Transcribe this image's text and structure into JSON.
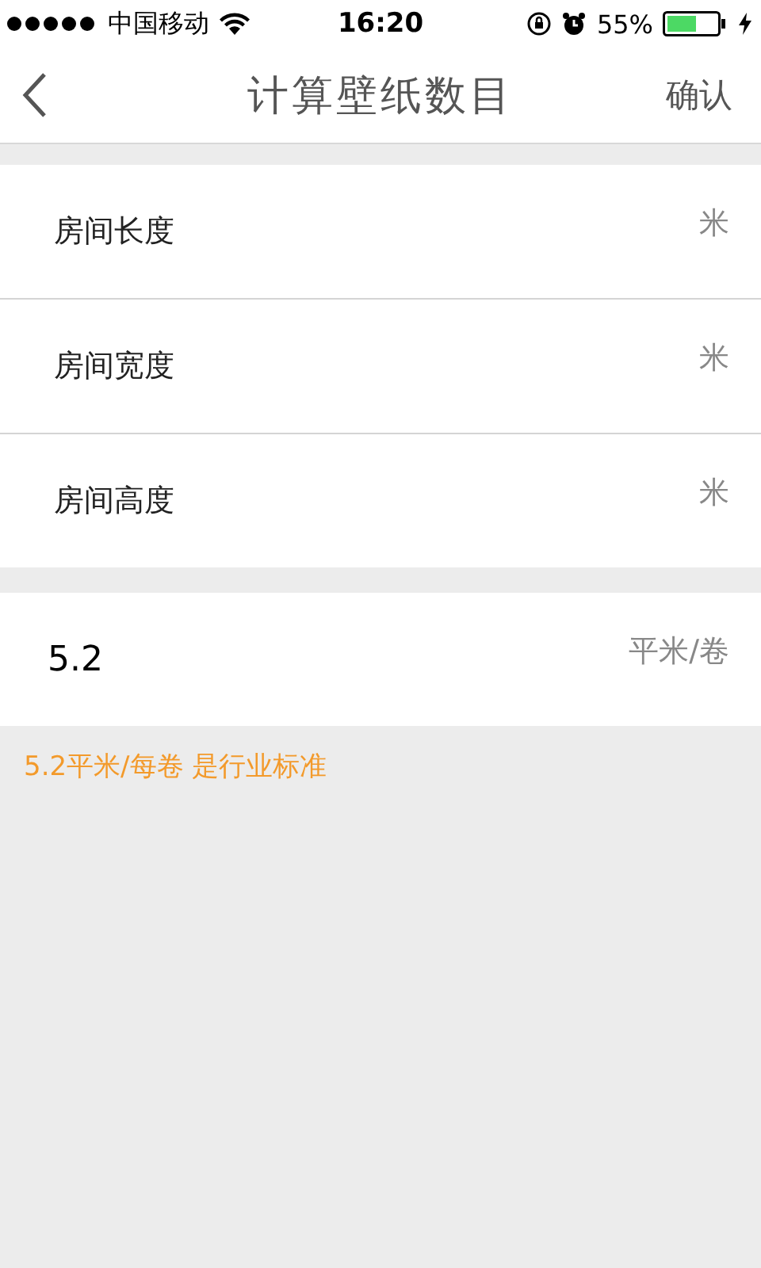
{
  "status_bar": {
    "carrier": "中国移动",
    "time": "16:20",
    "battery_percent": "55%"
  },
  "nav": {
    "title": "计算壁纸数目",
    "action": "确认"
  },
  "room_fields": [
    {
      "label": "房间长度",
      "unit": "米"
    },
    {
      "label": "房间宽度",
      "unit": "米"
    },
    {
      "label": "房间高度",
      "unit": "米"
    }
  ],
  "roll_field": {
    "value": "5.2",
    "unit": "平米/卷"
  },
  "note": "5.2平米/每卷 是行业标准"
}
